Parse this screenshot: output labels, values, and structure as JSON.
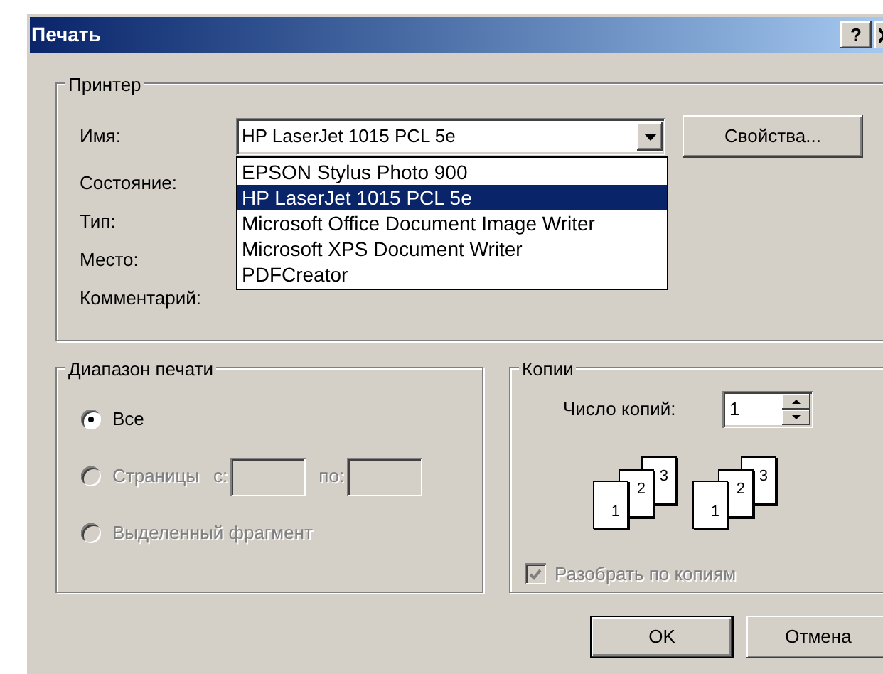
{
  "window": {
    "title": "Печать",
    "help_button": "?"
  },
  "printer": {
    "title": "Принтер",
    "name_label": {
      "text": "Имя:"
    },
    "selected_printer": "HP LaserJet 1015 PCL 5e",
    "properties_button": {
      "text": "Свойства..."
    },
    "info_labels": [
      "Состояние:",
      "Тип:",
      "Место:",
      "Комментарий:"
    ],
    "dropdown": {
      "expanded": true,
      "options": [
        {
          "label": "EPSON Stylus Photo 900",
          "selected": false
        },
        {
          "label": "HP LaserJet 1015 PCL 5e",
          "selected": true
        },
        {
          "label": "Microsoft Office Document Image Writer",
          "selected": false
        },
        {
          "label": "Microsoft XPS Document Writer",
          "selected": false
        },
        {
          "label": "PDFCreator",
          "selected": false
        }
      ]
    }
  },
  "range": {
    "title": "Диапазон печати",
    "options": [
      {
        "kind": "all",
        "label": "Все",
        "selected": true,
        "disabled": false
      },
      {
        "kind": "pages",
        "label": "Страницы",
        "selected": false,
        "disabled": true,
        "from_label": {
          "text": "с:"
        },
        "to_label": {
          "text": "по:"
        }
      },
      {
        "kind": "selection",
        "label": "Выделенный фрагмент",
        "selected": false,
        "disabled": true
      }
    ]
  },
  "copies": {
    "title": "Копии",
    "count_label": {
      "text": "Число копий:"
    },
    "count": "1",
    "illustrations": [
      {
        "pages": [
          "1",
          "2",
          "3"
        ]
      },
      {
        "pages": [
          "1",
          "2",
          "3"
        ]
      }
    ],
    "collate": {
      "label": "Разобрать по копиям",
      "checked": true,
      "disabled": true
    }
  },
  "buttons": [
    {
      "label": "OK",
      "default": true
    },
    {
      "label": "Отмена",
      "default": false
    }
  ]
}
